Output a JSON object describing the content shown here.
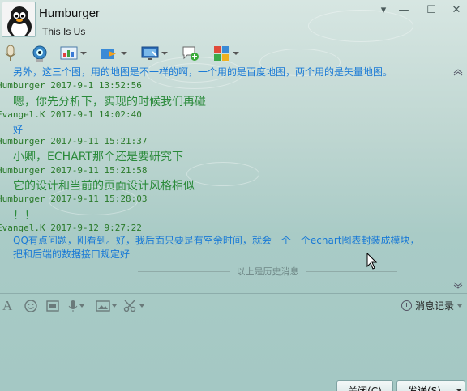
{
  "header": {
    "contact_name": "Humburger",
    "signature": "This Is Us",
    "window_controls": {
      "menu": "▾",
      "minimize": "—",
      "maximize": "☐",
      "close": "✕"
    }
  },
  "toolbar": {
    "buttons": [
      {
        "icon": "microphone-icon"
      },
      {
        "icon": "video-camera-icon"
      },
      {
        "icon": "app-chart-icon"
      },
      {
        "icon": "send-file-icon"
      },
      {
        "icon": "remote-desktop-icon"
      },
      {
        "icon": "create-group-icon"
      },
      {
        "icon": "apps-grid-icon"
      }
    ]
  },
  "messages": [
    {
      "type": "partial",
      "text": "另外，这三个图，用的地图是不一样的啊，一个用的是百度地图，两个用的是矢量地图。"
    },
    {
      "sender": "Humburger",
      "time": "2017-9-1 13:52:56",
      "text": "嗯，你先分析下，实现的时候我们再碰",
      "style": "green"
    },
    {
      "sender": "Evangel.K",
      "time": "2017-9-1 14:02:40",
      "text": "好",
      "style": "blue"
    },
    {
      "sender": "Humburger",
      "time": "2017-9-11 15:21:37",
      "text": "小卿，ECHART那个还是要研究下",
      "style": "green"
    },
    {
      "sender": "Humburger",
      "time": "2017-9-11 15:21:58",
      "text": "它的设计和当前的页面设计风格相似",
      "style": "green"
    },
    {
      "sender": "Humburger",
      "time": "2017-9-11 15:28:03",
      "text": "！！",
      "style": "green"
    },
    {
      "sender": "Evangel.K",
      "time": "2017-9-12 9:27:22",
      "lines": [
        "QQ有点问题，刚看到。好，我后面只要是有空余时间，就会一个一个echart图表封装成模块，",
        "把和后端的数据接口规定好"
      ],
      "style": "blue"
    }
  ],
  "history_divider": "以上是历史消息",
  "input_toolbar": {
    "icons": [
      "font-icon",
      "emoji-icon",
      "screenshot-icon",
      "voice-message-icon",
      "image-icon",
      "scissors-icon"
    ],
    "history_label": "消息记录"
  },
  "buttons": {
    "close_label": "关闭(C)",
    "send_label": "发送(S)"
  },
  "colors": {
    "green_text": "#2a8a3a",
    "blue_text": "#1a7ad6",
    "header_text": "#2a7a2a"
  }
}
